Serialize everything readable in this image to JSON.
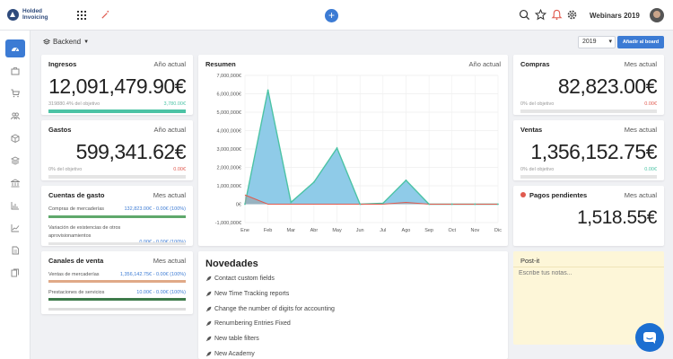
{
  "app": {
    "name_line1": "Holded",
    "name_line2": "Invoicing",
    "company": "Webinars 2019"
  },
  "icons": {
    "apps": "grid-icon",
    "magic": "magic-wand-icon",
    "add": "plus-icon",
    "search": "search-icon",
    "favorite": "star-icon",
    "notifications": "bell-icon",
    "settings": "gear-icon"
  },
  "colors": {
    "primary": "#3c7bd4",
    "teal": "#4cc3a5",
    "red": "#e05a4f",
    "chart_fill": "#8fcbe8",
    "chart_line": "#4cc3a5",
    "sales_bar": "#e0a987",
    "purchase_bar": "#5fa86b"
  },
  "sidebar": {
    "items": [
      {
        "name": "dashboard-icon",
        "active": true
      },
      {
        "name": "briefcase-icon"
      },
      {
        "name": "cart-icon"
      },
      {
        "name": "contacts-icon"
      },
      {
        "name": "box-icon"
      },
      {
        "name": "stack-icon"
      },
      {
        "name": "bank-icon"
      },
      {
        "name": "chart-icon"
      },
      {
        "name": "trend-icon"
      },
      {
        "name": "document-icon"
      },
      {
        "name": "documents-icon"
      }
    ]
  },
  "toolbar": {
    "board_label": "Backend",
    "year": "2019",
    "add_board": "Añadir al board"
  },
  "ingresos": {
    "title": "Ingresos",
    "period": "Año actual",
    "value": "12,091,479.90€",
    "objective_text": "319880.4% del objetivo",
    "objective_value": "3,780.00€",
    "progress": 1.0
  },
  "gastos": {
    "title": "Gastos",
    "period": "Año actual",
    "value": "599,341.62€",
    "objective_text": "0% del objetivo",
    "objective_value": "0.00€",
    "progress": 0
  },
  "cuentas_gasto": {
    "title": "Cuentas de gasto",
    "period": "Mes actual",
    "rows": [
      {
        "label": "Compras de mercaderías",
        "value": "132,823.00€ - 0.00€ (100%)"
      },
      {
        "label_line1": "Variación de existencias de otros",
        "label_line2": "aprovisionamientos",
        "value": "0.00€ - 0.00€ (100%)"
      }
    ]
  },
  "canales_venta": {
    "title": "Canales de venta",
    "period": "Mes actual",
    "rows": [
      {
        "label": "Ventas de mercaderías",
        "value": "1,356,142.75€ - 0.00€ (100%)"
      },
      {
        "label": "Prestaciones de servicios",
        "value": "10.00€ - 0.00€ (100%)"
      }
    ]
  },
  "resumen": {
    "title": "Resumen",
    "period": "Año actual"
  },
  "chart_data": {
    "type": "area",
    "categories": [
      "Ene",
      "Feb",
      "Mar",
      "Abr",
      "May",
      "Jun",
      "Jul",
      "Ago",
      "Sep",
      "Oct",
      "Nov",
      "Dic"
    ],
    "y_ticks": [
      "7,000,000€",
      "6,000,000€",
      "5,000,000€",
      "4,000,000€",
      "3,000,000€",
      "2,000,000€",
      "1,000,000€",
      "0€",
      "-1,000,000€"
    ],
    "ylim": [
      -1000000,
      7000000
    ],
    "grid": true,
    "series": [
      {
        "values": [
          0,
          6200000,
          100000,
          1200000,
          3050000,
          0,
          50000,
          1300000,
          0,
          0,
          0,
          0
        ]
      },
      {
        "values": [
          500000,
          0,
          0,
          0,
          0,
          0,
          0,
          100000,
          0,
          0,
          0,
          0
        ]
      }
    ]
  },
  "novedades": {
    "title": "Novedades",
    "items": [
      "Contact custom fields",
      "New Time Tracking reports",
      "Change the number of digits for accounting",
      "Renumbering Entries Fixed",
      "New table filters",
      "New Academy"
    ]
  },
  "compras": {
    "title": "Compras",
    "period": "Mes actual",
    "value": "82,823.00€",
    "objective_text": "0% del objetivo",
    "objective_value": "0.00€"
  },
  "ventas": {
    "title": "Ventas",
    "period": "Mes actual",
    "value": "1,356,152.75€",
    "objective_text": "0% del objetivo",
    "objective_value": "0.00€"
  },
  "pendientes": {
    "title": "Pagos pendientes",
    "period": "Mes actual",
    "value": "1,518.55€"
  },
  "postit": {
    "title": "Post-it",
    "placeholder": "Escribe tus notas..."
  }
}
